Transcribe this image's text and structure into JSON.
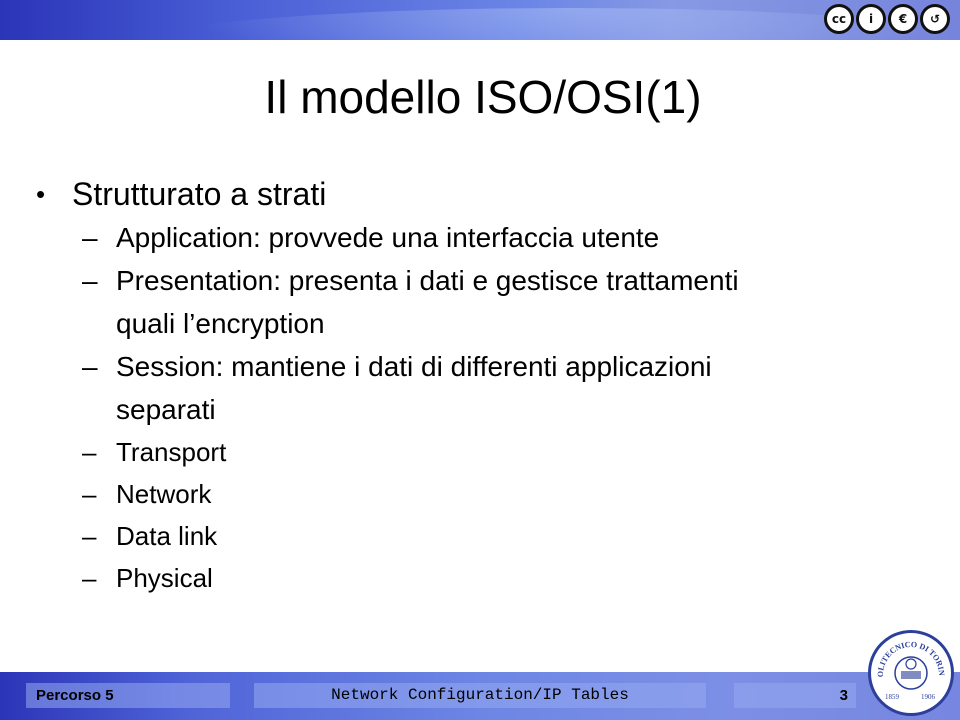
{
  "header": {
    "license_icons": [
      "cc-icon",
      "attribution-icon",
      "noncommercial-icon",
      "sharealike-icon"
    ],
    "license_labels": [
      "cc",
      "i",
      "€",
      "↺"
    ]
  },
  "slide": {
    "title": "Il modello ISO/OSI(1)",
    "bullet": "Strutturato a strati",
    "subitems": [
      {
        "text": "Application: provvede una interfaccia utente"
      },
      {
        "text": "Presentation: presenta i dati e gestisce trattamenti",
        "cont": "quali l’encryption"
      },
      {
        "text": "Session: mantiene i dati di differenti applicazioni",
        "cont": "separati"
      },
      {
        "text": "Transport"
      },
      {
        "text": "Network"
      },
      {
        "text": "Data link"
      },
      {
        "text": "Physical"
      }
    ]
  },
  "footer": {
    "course": "Percorso 5",
    "topic": "Network Configuration/IP Tables",
    "page_number": "3",
    "logo_text": "POLITECNICO DI TORINO",
    "logo_years": [
      "1859",
      "1906"
    ]
  }
}
